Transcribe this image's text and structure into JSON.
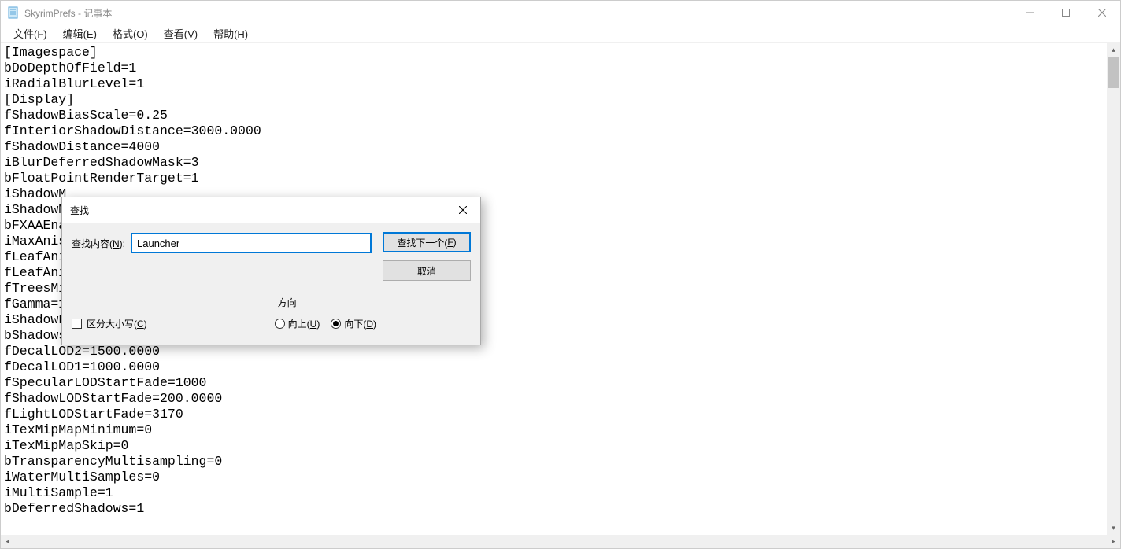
{
  "window": {
    "title": "SkyrimPrefs - 记事本"
  },
  "menu": {
    "file": "文件(F)",
    "edit": "编辑(E)",
    "format": "格式(O)",
    "view": "查看(V)",
    "help": "帮助(H)"
  },
  "content": "[Imagespace]\nbDoDepthOfField=1\niRadialBlurLevel=1\n[Display]\nfShadowBiasScale=0.25\nfInteriorShadowDistance=3000.0000\nfShadowDistance=4000\niBlurDeferredShadowMask=3\nbFloatPointRenderTarget=1\niShadowM\niShadowM\nbFXAAEna\niMaxAnis\nfLeafAni\nfLeafAni\nfTreesMi\nfGamma=1\niShadowF\nbShadows\nfDecalLOD2=1500.0000\nfDecalLOD1=1000.0000\nfSpecularLODStartFade=1000\nfShadowLODStartFade=200.0000\nfLightLODStartFade=3170\niTexMipMapMinimum=0\niTexMipMapSkip=0\nbTransparencyMultisampling=0\niWaterMultiSamples=0\niMultiSample=1\nbDeferredShadows=1",
  "find": {
    "title": "查找",
    "label_prefix": "查找内容(",
    "label_suffix": "):",
    "value": "Launcher",
    "findNext_prefix": "查找下一个(",
    "findNext_suffix": ")",
    "cancel": "取消",
    "matchCase_prefix": "区分大小写(",
    "matchCase_suffix": ")",
    "direction": "方向",
    "up_prefix": "向上(",
    "up_suffix": ")",
    "down_prefix": "向下(",
    "down_suffix": ")"
  }
}
